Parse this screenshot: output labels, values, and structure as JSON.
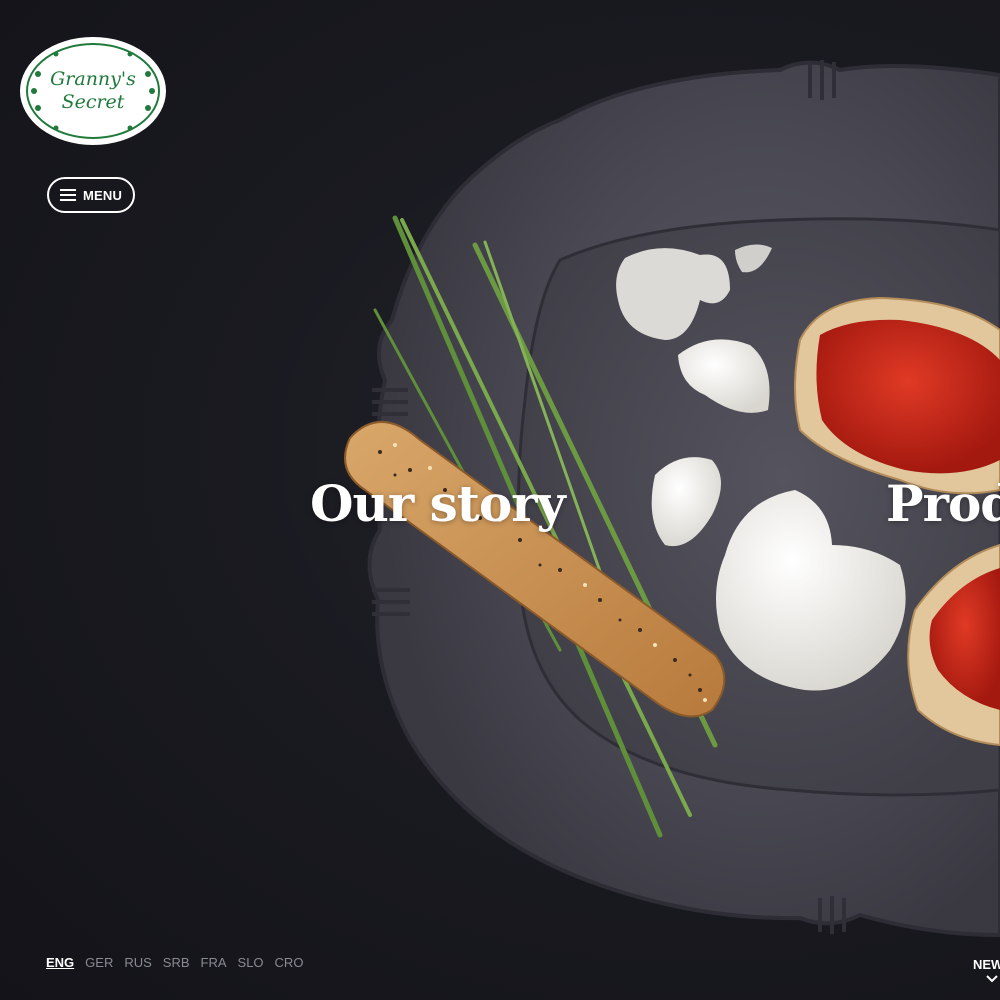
{
  "brand": {
    "logo_line1": "Granny's",
    "logo_line2": "Secret",
    "logo_color": "#1f7a3c"
  },
  "menu": {
    "label": "MENU",
    "icon": "hamburger-icon"
  },
  "slides": [
    {
      "title": "Our story"
    },
    {
      "title": "Prod"
    }
  ],
  "languages": [
    {
      "code": "ENG",
      "active": true
    },
    {
      "code": "GER",
      "active": false
    },
    {
      "code": "RUS",
      "active": false
    },
    {
      "code": "SRB",
      "active": false
    },
    {
      "code": "FRA",
      "active": false
    },
    {
      "code": "SLO",
      "active": false
    },
    {
      "code": "CRO",
      "active": false
    }
  ],
  "news": {
    "label": "NEW",
    "icon": "chevron-down-icon"
  },
  "colors": {
    "background": "#16161d",
    "text": "#ffffff",
    "inactive_lang": "#8a8a93"
  }
}
